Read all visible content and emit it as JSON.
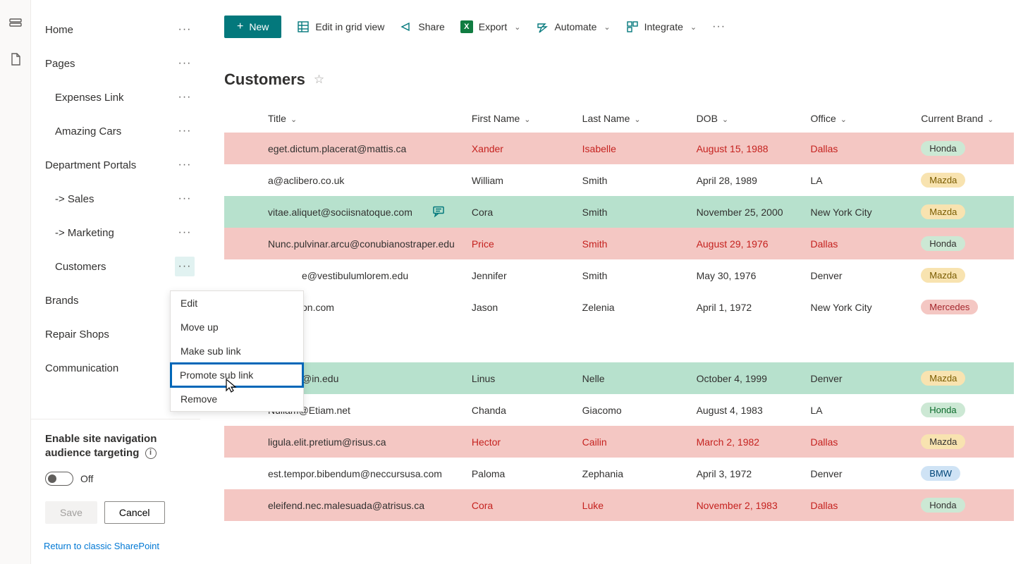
{
  "rail": {
    "icons": [
      "database-icon",
      "file-icon"
    ]
  },
  "sidebar": {
    "items": [
      {
        "label": "Home",
        "level": 0
      },
      {
        "label": "Pages",
        "level": 0
      },
      {
        "label": "Expenses Link",
        "level": 1
      },
      {
        "label": "Amazing Cars",
        "level": 1
      },
      {
        "label": "Department Portals",
        "level": 0
      },
      {
        "label": "-> Sales",
        "level": 1
      },
      {
        "label": "-> Marketing",
        "level": 1
      },
      {
        "label": "Customers",
        "level": 1,
        "more_active": true
      },
      {
        "label": "Brands",
        "level": 0
      },
      {
        "label": "Repair Shops",
        "level": 0
      },
      {
        "label": "Communication",
        "level": 0
      }
    ],
    "audience_heading": "Enable site navigation audience targeting",
    "toggle_label": "Off",
    "save_label": "Save",
    "cancel_label": "Cancel",
    "return_link": "Return to classic SharePoint"
  },
  "context_menu": {
    "items": [
      {
        "label": "Edit"
      },
      {
        "label": "Move up"
      },
      {
        "label": "Make sub link"
      },
      {
        "label": "Promote sub link",
        "highlighted": true
      },
      {
        "label": "Remove"
      }
    ]
  },
  "cmdbar": {
    "new_label": "New",
    "edit_grid": "Edit in grid view",
    "share": "Share",
    "export": "Export",
    "automate": "Automate",
    "integrate": "Integrate"
  },
  "list_title": "Customers",
  "columns": {
    "title": "Title",
    "first_name": "First Name",
    "last_name": "Last Name",
    "dob": "DOB",
    "office": "Office",
    "brand": "Current Brand"
  },
  "rows": [
    {
      "title": "eget.dictum.placerat@mattis.ca",
      "first_name": "Xander",
      "last_name": "Isabelle",
      "dob": "August 15, 1988",
      "office": "Dallas",
      "brand": "Honda",
      "row_style": "pink"
    },
    {
      "title": "a@aclibero.co.uk",
      "first_name": "William",
      "last_name": "Smith",
      "dob": "April 28, 1989",
      "office": "LA",
      "brand": "Mazda",
      "row_style": "plain"
    },
    {
      "title": "vitae.aliquet@sociisnatoque.com",
      "first_name": "Cora",
      "last_name": "Smith",
      "dob": "November 25, 2000",
      "office": "New York City",
      "brand": "Mazda",
      "row_style": "green",
      "has_comment": true
    },
    {
      "title": "Nunc.pulvinar.arcu@conubianostraper.edu",
      "first_name": "Price",
      "last_name": "Smith",
      "dob": "August 29, 1976",
      "office": "Dallas",
      "brand": "Honda",
      "row_style": "pink"
    },
    {
      "title": "e@vestibulumlorem.edu",
      "first_name": "Jennifer",
      "last_name": "Smith",
      "dob": "May 30, 1976",
      "office": "Denver",
      "brand": "Mazda",
      "row_style": "plain",
      "partial_left": true
    },
    {
      "title": "on.com",
      "first_name": "Jason",
      "last_name": "Zelenia",
      "dob": "April 1, 1972",
      "office": "New York City",
      "brand": "Mercedes",
      "row_style": "plain",
      "partial_left": true
    },
    {
      "gap": true
    },
    {
      "title": "@in.edu",
      "first_name": "Linus",
      "last_name": "Nelle",
      "dob": "October 4, 1999",
      "office": "Denver",
      "brand": "Mazda",
      "row_style": "green",
      "partial_left": true
    },
    {
      "title": "Nullam@Etiam.net",
      "first_name": "Chanda",
      "last_name": "Giacomo",
      "dob": "August 4, 1983",
      "office": "LA",
      "brand": "Honda",
      "row_style": "plain"
    },
    {
      "title": "ligula.elit.pretium@risus.ca",
      "first_name": "Hector",
      "last_name": "Cailin",
      "dob": "March 2, 1982",
      "office": "Dallas",
      "brand": "Mazda",
      "row_style": "pink"
    },
    {
      "title": "est.tempor.bibendum@neccursusa.com",
      "first_name": "Paloma",
      "last_name": "Zephania",
      "dob": "April 3, 1972",
      "office": "Denver",
      "brand": "BMW",
      "row_style": "plain"
    },
    {
      "title": "eleifend.nec.malesuada@atrisus.ca",
      "first_name": "Cora",
      "last_name": "Luke",
      "dob": "November 2, 1983",
      "office": "Dallas",
      "brand": "Honda",
      "row_style": "pink"
    }
  ],
  "brand_pill": {
    "Honda": "pill-honda",
    "Mazda": "pill-mazda",
    "Mercedes": "pill-mercedes",
    "BMW": "pill-bmw"
  }
}
